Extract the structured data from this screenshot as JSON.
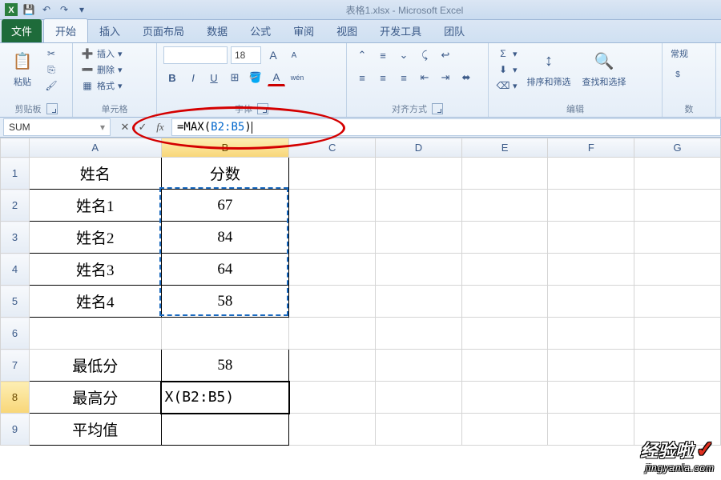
{
  "window": {
    "title": "表格1.xlsx - Microsoft Excel"
  },
  "tabs": {
    "file": "文件",
    "home": "开始",
    "insert": "插入",
    "layout": "页面布局",
    "data": "数据",
    "formulas": "公式",
    "review": "审阅",
    "view": "视图",
    "dev": "开发工具",
    "team": "团队"
  },
  "ribbon": {
    "paste": "粘贴",
    "clipboard": "剪贴板",
    "ins": "插入",
    "del": "删除",
    "fmt": "格式",
    "cells": "单元格",
    "font_size": "18",
    "font": "字体",
    "align": "对齐方式",
    "sort": "排序和筛选",
    "find": "查找和选择",
    "edit": "编辑",
    "numlab": "数",
    "normal": "常规"
  },
  "fbar": {
    "name": "SUM",
    "formula_pre": "=MAX(",
    "formula_ref": "B2:B5",
    "formula_post": ")"
  },
  "cols": [
    "A",
    "B",
    "C",
    "D",
    "E",
    "F",
    "G"
  ],
  "rows": [
    "1",
    "2",
    "3",
    "4",
    "5",
    "6",
    "7",
    "8",
    "9"
  ],
  "cells": {
    "A1": "姓名",
    "B1": "分数",
    "A2": "姓名1",
    "B2": "67",
    "A3": "姓名2",
    "B3": "84",
    "A4": "姓名3",
    "B4": "64",
    "A5": "姓名4",
    "B5": "58",
    "A7": "最低分",
    "B7": "58",
    "A8": "最高分",
    "B8": "X(B2:B5)",
    "A9": "平均值"
  },
  "wm": {
    "big": "经验啦",
    "chk": "✓",
    "small": "jingyanla.com"
  },
  "chart_data": {
    "type": "table",
    "title": "分数",
    "categories": [
      "姓名1",
      "姓名2",
      "姓名3",
      "姓名4"
    ],
    "values": [
      67,
      84,
      64,
      58
    ],
    "derived": {
      "最低分": 58,
      "最高分": "=MAX(B2:B5)",
      "平均值": ""
    }
  }
}
